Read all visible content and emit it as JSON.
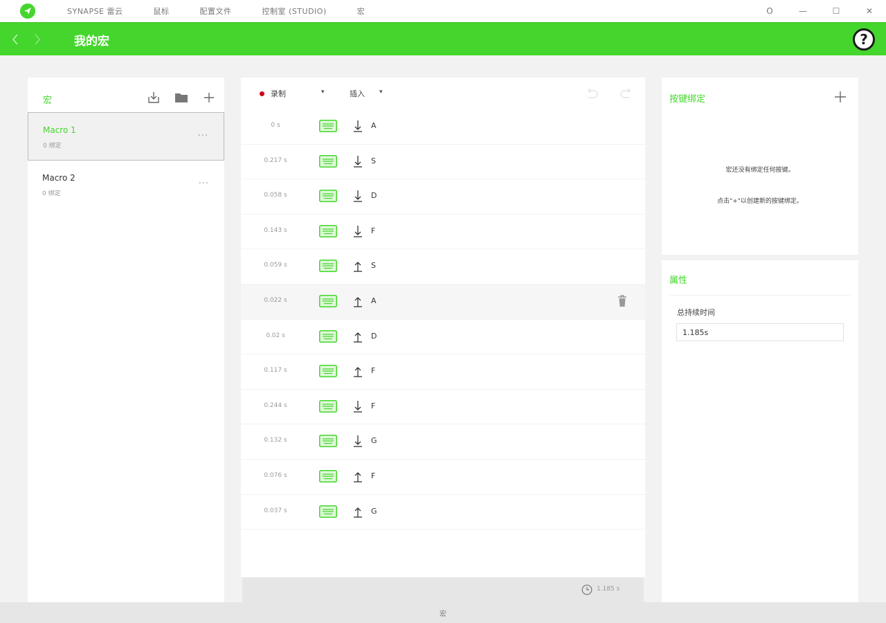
{
  "titlebar": {
    "nav": [
      "SYNAPSE 雷云",
      "鼠标",
      "配置文件",
      "控制室 (STUDIO)",
      "宏"
    ],
    "controls": {
      "account": "O",
      "minimize": "—",
      "maximize": "☐",
      "close": "✕"
    }
  },
  "header": {
    "title": "我的宏",
    "help": "?"
  },
  "colors": {
    "accent": "#44d62c",
    "record": "#d0021b"
  },
  "macros": {
    "section_label": "宏",
    "items": [
      {
        "name": "Macro 1",
        "sub": "0 绑定",
        "selected": true
      },
      {
        "name": "Macro 2",
        "sub": "0 绑定",
        "selected": false
      }
    ],
    "more": "···"
  },
  "editor": {
    "record_label": "录制",
    "insert_label": "插入",
    "dropdown": "▾",
    "events": [
      {
        "time": "0 s",
        "dir": "down",
        "key": "A"
      },
      {
        "time": "0.217 s",
        "dir": "down",
        "key": "S"
      },
      {
        "time": "0.058 s",
        "dir": "down",
        "key": "D"
      },
      {
        "time": "0.143 s",
        "dir": "down",
        "key": "F"
      },
      {
        "time": "0.059 s",
        "dir": "up",
        "key": "S"
      },
      {
        "time": "0.022 s",
        "dir": "up",
        "key": "A"
      },
      {
        "time": "0.02 s",
        "dir": "up",
        "key": "D"
      },
      {
        "time": "0.117 s",
        "dir": "up",
        "key": "F"
      },
      {
        "time": "0.244 s",
        "dir": "down",
        "key": "F"
      },
      {
        "time": "0.132 s",
        "dir": "down",
        "key": "G"
      },
      {
        "time": "0.076 s",
        "dir": "up",
        "key": "F"
      },
      {
        "time": "0.037 s",
        "dir": "up",
        "key": "G"
      }
    ],
    "total": "1.185 s"
  },
  "binding": {
    "title": "按键绑定",
    "empty_line1": "宏还没有绑定任何按键。",
    "empty_line2": "点击\"+\"以创建新的按键绑定。"
  },
  "properties": {
    "title": "属性",
    "duration_label": "总持续时间",
    "duration_value": "1.185s"
  },
  "status_bar": {
    "text": "宏"
  }
}
